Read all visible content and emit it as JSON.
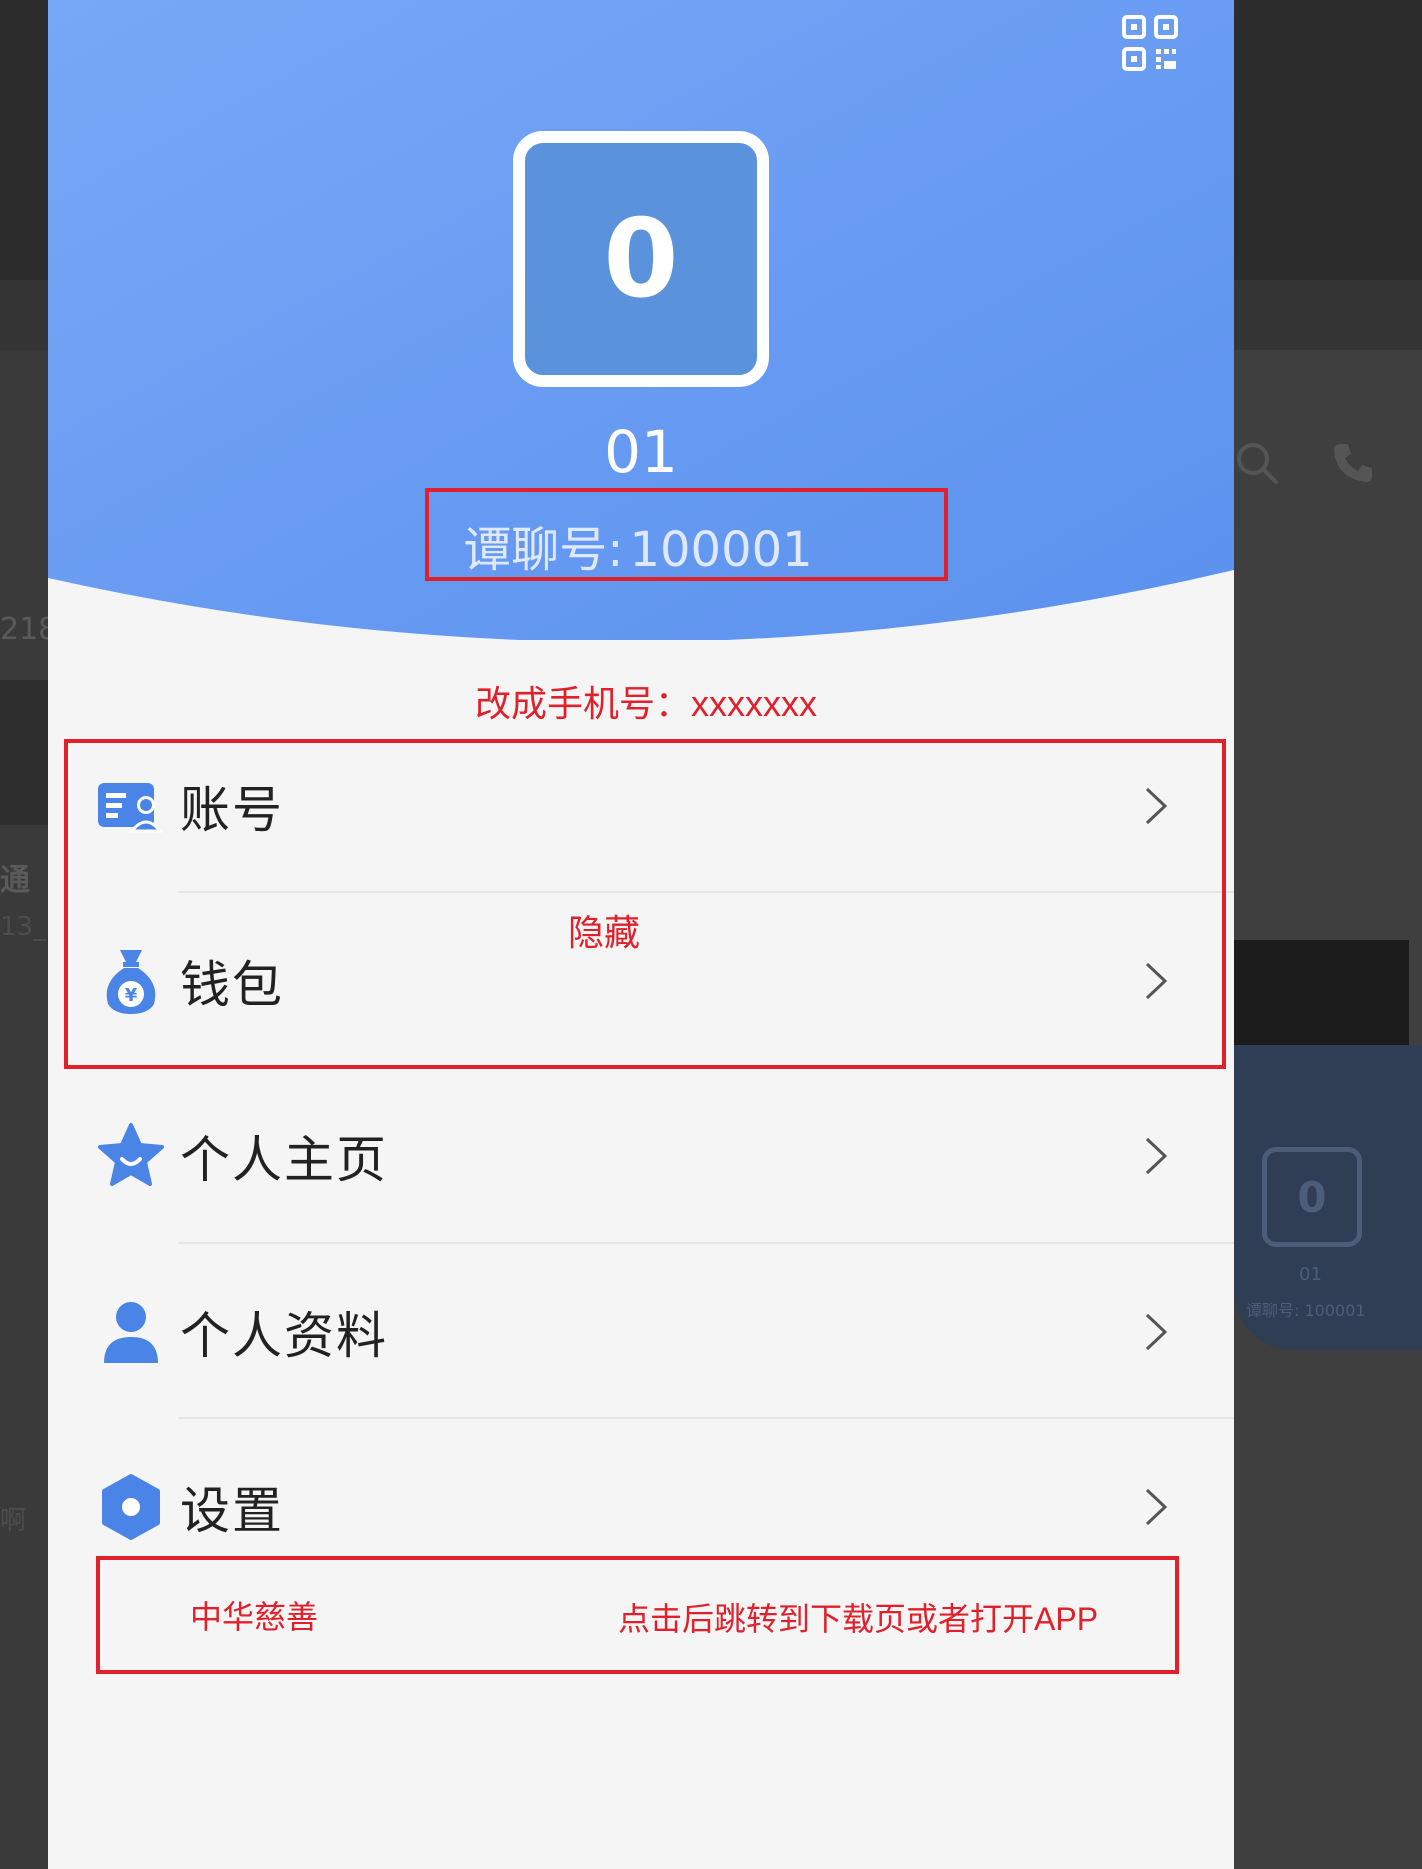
{
  "background": {
    "left_fragments": [
      "218",
      "通",
      "13_",
      "啊"
    ],
    "mini_profile": {
      "avatar_char": "0",
      "name": "01",
      "id_line": "谭聊号: 100001"
    }
  },
  "header": {
    "qr_icon": "qr-code-icon",
    "avatar_char": "0",
    "username": "01",
    "id_label": "谭聊号:",
    "id_value": "100001",
    "gradient_colors": [
      "#6fa3f8",
      "#5b91ee"
    ]
  },
  "annotations": {
    "change_to_phone": "改成手机号：xxxxxxx",
    "hide": "隐藏",
    "charity_label": "中华慈善",
    "charity_action": "点击后跳转到下载页或者打开APP",
    "color": "#e0202a"
  },
  "menu": [
    {
      "label": "账号",
      "icon": "account-card-icon"
    },
    {
      "label": "钱包",
      "icon": "money-bag-icon"
    },
    {
      "label": "个人主页",
      "icon": "star-icon"
    },
    {
      "label": "个人资料",
      "icon": "person-icon"
    },
    {
      "label": "设置",
      "icon": "settings-hexagon-icon"
    }
  ]
}
